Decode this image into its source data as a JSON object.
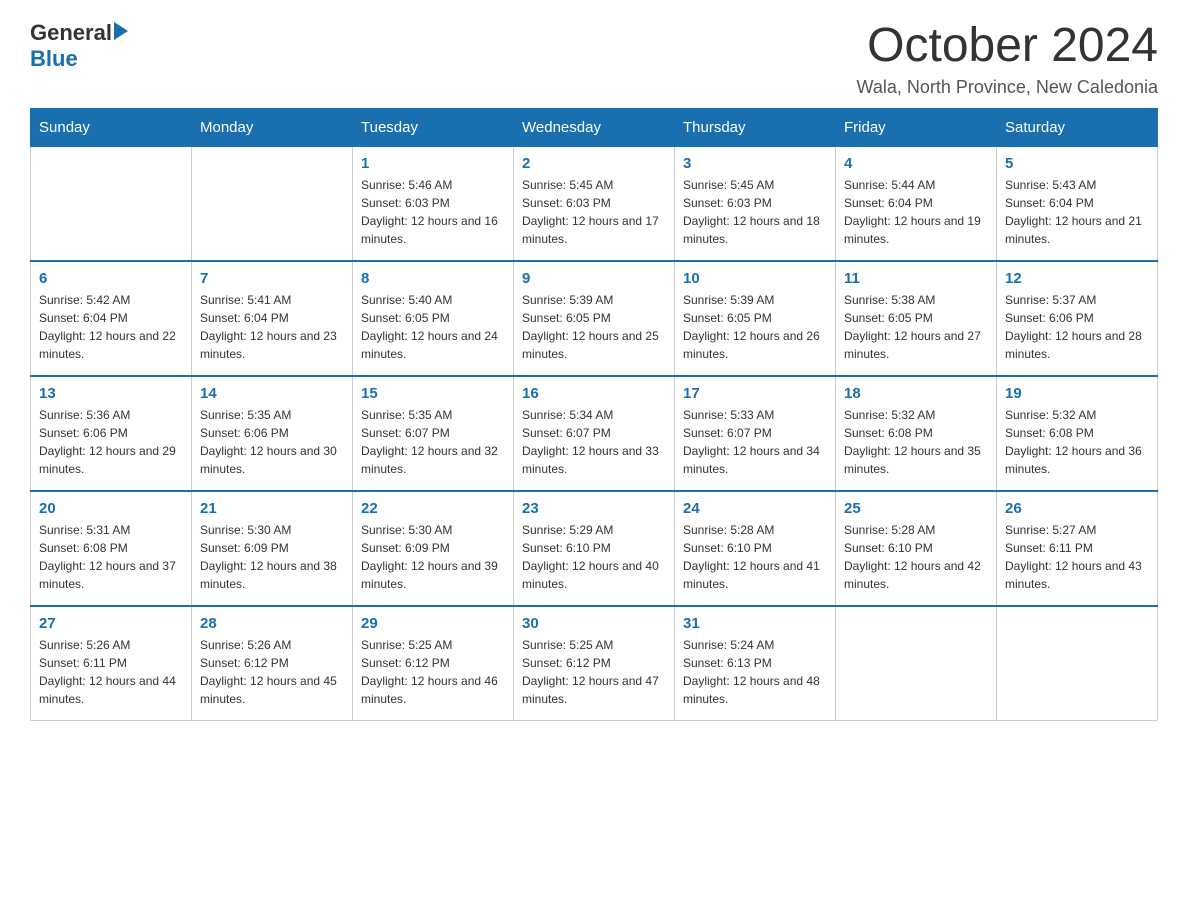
{
  "header": {
    "title": "October 2024",
    "location": "Wala, North Province, New Caledonia"
  },
  "logo": {
    "general": "General",
    "blue": "Blue"
  },
  "days_of_week": [
    "Sunday",
    "Monday",
    "Tuesday",
    "Wednesday",
    "Thursday",
    "Friday",
    "Saturday"
  ],
  "weeks": [
    [
      {
        "day": "",
        "sunrise": "",
        "sunset": "",
        "daylight": ""
      },
      {
        "day": "",
        "sunrise": "",
        "sunset": "",
        "daylight": ""
      },
      {
        "day": "1",
        "sunrise": "Sunrise: 5:46 AM",
        "sunset": "Sunset: 6:03 PM",
        "daylight": "Daylight: 12 hours and 16 minutes."
      },
      {
        "day": "2",
        "sunrise": "Sunrise: 5:45 AM",
        "sunset": "Sunset: 6:03 PM",
        "daylight": "Daylight: 12 hours and 17 minutes."
      },
      {
        "day": "3",
        "sunrise": "Sunrise: 5:45 AM",
        "sunset": "Sunset: 6:03 PM",
        "daylight": "Daylight: 12 hours and 18 minutes."
      },
      {
        "day": "4",
        "sunrise": "Sunrise: 5:44 AM",
        "sunset": "Sunset: 6:04 PM",
        "daylight": "Daylight: 12 hours and 19 minutes."
      },
      {
        "day": "5",
        "sunrise": "Sunrise: 5:43 AM",
        "sunset": "Sunset: 6:04 PM",
        "daylight": "Daylight: 12 hours and 21 minutes."
      }
    ],
    [
      {
        "day": "6",
        "sunrise": "Sunrise: 5:42 AM",
        "sunset": "Sunset: 6:04 PM",
        "daylight": "Daylight: 12 hours and 22 minutes."
      },
      {
        "day": "7",
        "sunrise": "Sunrise: 5:41 AM",
        "sunset": "Sunset: 6:04 PM",
        "daylight": "Daylight: 12 hours and 23 minutes."
      },
      {
        "day": "8",
        "sunrise": "Sunrise: 5:40 AM",
        "sunset": "Sunset: 6:05 PM",
        "daylight": "Daylight: 12 hours and 24 minutes."
      },
      {
        "day": "9",
        "sunrise": "Sunrise: 5:39 AM",
        "sunset": "Sunset: 6:05 PM",
        "daylight": "Daylight: 12 hours and 25 minutes."
      },
      {
        "day": "10",
        "sunrise": "Sunrise: 5:39 AM",
        "sunset": "Sunset: 6:05 PM",
        "daylight": "Daylight: 12 hours and 26 minutes."
      },
      {
        "day": "11",
        "sunrise": "Sunrise: 5:38 AM",
        "sunset": "Sunset: 6:05 PM",
        "daylight": "Daylight: 12 hours and 27 minutes."
      },
      {
        "day": "12",
        "sunrise": "Sunrise: 5:37 AM",
        "sunset": "Sunset: 6:06 PM",
        "daylight": "Daylight: 12 hours and 28 minutes."
      }
    ],
    [
      {
        "day": "13",
        "sunrise": "Sunrise: 5:36 AM",
        "sunset": "Sunset: 6:06 PM",
        "daylight": "Daylight: 12 hours and 29 minutes."
      },
      {
        "day": "14",
        "sunrise": "Sunrise: 5:35 AM",
        "sunset": "Sunset: 6:06 PM",
        "daylight": "Daylight: 12 hours and 30 minutes."
      },
      {
        "day": "15",
        "sunrise": "Sunrise: 5:35 AM",
        "sunset": "Sunset: 6:07 PM",
        "daylight": "Daylight: 12 hours and 32 minutes."
      },
      {
        "day": "16",
        "sunrise": "Sunrise: 5:34 AM",
        "sunset": "Sunset: 6:07 PM",
        "daylight": "Daylight: 12 hours and 33 minutes."
      },
      {
        "day": "17",
        "sunrise": "Sunrise: 5:33 AM",
        "sunset": "Sunset: 6:07 PM",
        "daylight": "Daylight: 12 hours and 34 minutes."
      },
      {
        "day": "18",
        "sunrise": "Sunrise: 5:32 AM",
        "sunset": "Sunset: 6:08 PM",
        "daylight": "Daylight: 12 hours and 35 minutes."
      },
      {
        "day": "19",
        "sunrise": "Sunrise: 5:32 AM",
        "sunset": "Sunset: 6:08 PM",
        "daylight": "Daylight: 12 hours and 36 minutes."
      }
    ],
    [
      {
        "day": "20",
        "sunrise": "Sunrise: 5:31 AM",
        "sunset": "Sunset: 6:08 PM",
        "daylight": "Daylight: 12 hours and 37 minutes."
      },
      {
        "day": "21",
        "sunrise": "Sunrise: 5:30 AM",
        "sunset": "Sunset: 6:09 PM",
        "daylight": "Daylight: 12 hours and 38 minutes."
      },
      {
        "day": "22",
        "sunrise": "Sunrise: 5:30 AM",
        "sunset": "Sunset: 6:09 PM",
        "daylight": "Daylight: 12 hours and 39 minutes."
      },
      {
        "day": "23",
        "sunrise": "Sunrise: 5:29 AM",
        "sunset": "Sunset: 6:10 PM",
        "daylight": "Daylight: 12 hours and 40 minutes."
      },
      {
        "day": "24",
        "sunrise": "Sunrise: 5:28 AM",
        "sunset": "Sunset: 6:10 PM",
        "daylight": "Daylight: 12 hours and 41 minutes."
      },
      {
        "day": "25",
        "sunrise": "Sunrise: 5:28 AM",
        "sunset": "Sunset: 6:10 PM",
        "daylight": "Daylight: 12 hours and 42 minutes."
      },
      {
        "day": "26",
        "sunrise": "Sunrise: 5:27 AM",
        "sunset": "Sunset: 6:11 PM",
        "daylight": "Daylight: 12 hours and 43 minutes."
      }
    ],
    [
      {
        "day": "27",
        "sunrise": "Sunrise: 5:26 AM",
        "sunset": "Sunset: 6:11 PM",
        "daylight": "Daylight: 12 hours and 44 minutes."
      },
      {
        "day": "28",
        "sunrise": "Sunrise: 5:26 AM",
        "sunset": "Sunset: 6:12 PM",
        "daylight": "Daylight: 12 hours and 45 minutes."
      },
      {
        "day": "29",
        "sunrise": "Sunrise: 5:25 AM",
        "sunset": "Sunset: 6:12 PM",
        "daylight": "Daylight: 12 hours and 46 minutes."
      },
      {
        "day": "30",
        "sunrise": "Sunrise: 5:25 AM",
        "sunset": "Sunset: 6:12 PM",
        "daylight": "Daylight: 12 hours and 47 minutes."
      },
      {
        "day": "31",
        "sunrise": "Sunrise: 5:24 AM",
        "sunset": "Sunset: 6:13 PM",
        "daylight": "Daylight: 12 hours and 48 minutes."
      },
      {
        "day": "",
        "sunrise": "",
        "sunset": "",
        "daylight": ""
      },
      {
        "day": "",
        "sunrise": "",
        "sunset": "",
        "daylight": ""
      }
    ]
  ]
}
